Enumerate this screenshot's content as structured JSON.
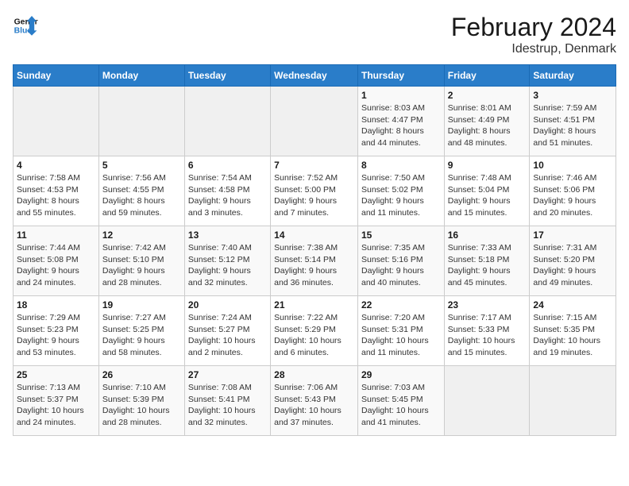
{
  "header": {
    "logo_line1": "General",
    "logo_line2": "Blue",
    "title": "February 2024",
    "subtitle": "Idestrup, Denmark"
  },
  "calendar": {
    "days_of_week": [
      "Sunday",
      "Monday",
      "Tuesday",
      "Wednesday",
      "Thursday",
      "Friday",
      "Saturday"
    ],
    "weeks": [
      [
        {
          "day": "",
          "info": ""
        },
        {
          "day": "",
          "info": ""
        },
        {
          "day": "",
          "info": ""
        },
        {
          "day": "",
          "info": ""
        },
        {
          "day": "1",
          "info": "Sunrise: 8:03 AM\nSunset: 4:47 PM\nDaylight: 8 hours\nand 44 minutes."
        },
        {
          "day": "2",
          "info": "Sunrise: 8:01 AM\nSunset: 4:49 PM\nDaylight: 8 hours\nand 48 minutes."
        },
        {
          "day": "3",
          "info": "Sunrise: 7:59 AM\nSunset: 4:51 PM\nDaylight: 8 hours\nand 51 minutes."
        }
      ],
      [
        {
          "day": "4",
          "info": "Sunrise: 7:58 AM\nSunset: 4:53 PM\nDaylight: 8 hours\nand 55 minutes."
        },
        {
          "day": "5",
          "info": "Sunrise: 7:56 AM\nSunset: 4:55 PM\nDaylight: 8 hours\nand 59 minutes."
        },
        {
          "day": "6",
          "info": "Sunrise: 7:54 AM\nSunset: 4:58 PM\nDaylight: 9 hours\nand 3 minutes."
        },
        {
          "day": "7",
          "info": "Sunrise: 7:52 AM\nSunset: 5:00 PM\nDaylight: 9 hours\nand 7 minutes."
        },
        {
          "day": "8",
          "info": "Sunrise: 7:50 AM\nSunset: 5:02 PM\nDaylight: 9 hours\nand 11 minutes."
        },
        {
          "day": "9",
          "info": "Sunrise: 7:48 AM\nSunset: 5:04 PM\nDaylight: 9 hours\nand 15 minutes."
        },
        {
          "day": "10",
          "info": "Sunrise: 7:46 AM\nSunset: 5:06 PM\nDaylight: 9 hours\nand 20 minutes."
        }
      ],
      [
        {
          "day": "11",
          "info": "Sunrise: 7:44 AM\nSunset: 5:08 PM\nDaylight: 9 hours\nand 24 minutes."
        },
        {
          "day": "12",
          "info": "Sunrise: 7:42 AM\nSunset: 5:10 PM\nDaylight: 9 hours\nand 28 minutes."
        },
        {
          "day": "13",
          "info": "Sunrise: 7:40 AM\nSunset: 5:12 PM\nDaylight: 9 hours\nand 32 minutes."
        },
        {
          "day": "14",
          "info": "Sunrise: 7:38 AM\nSunset: 5:14 PM\nDaylight: 9 hours\nand 36 minutes."
        },
        {
          "day": "15",
          "info": "Sunrise: 7:35 AM\nSunset: 5:16 PM\nDaylight: 9 hours\nand 40 minutes."
        },
        {
          "day": "16",
          "info": "Sunrise: 7:33 AM\nSunset: 5:18 PM\nDaylight: 9 hours\nand 45 minutes."
        },
        {
          "day": "17",
          "info": "Sunrise: 7:31 AM\nSunset: 5:20 PM\nDaylight: 9 hours\nand 49 minutes."
        }
      ],
      [
        {
          "day": "18",
          "info": "Sunrise: 7:29 AM\nSunset: 5:23 PM\nDaylight: 9 hours\nand 53 minutes."
        },
        {
          "day": "19",
          "info": "Sunrise: 7:27 AM\nSunset: 5:25 PM\nDaylight: 9 hours\nand 58 minutes."
        },
        {
          "day": "20",
          "info": "Sunrise: 7:24 AM\nSunset: 5:27 PM\nDaylight: 10 hours\nand 2 minutes."
        },
        {
          "day": "21",
          "info": "Sunrise: 7:22 AM\nSunset: 5:29 PM\nDaylight: 10 hours\nand 6 minutes."
        },
        {
          "day": "22",
          "info": "Sunrise: 7:20 AM\nSunset: 5:31 PM\nDaylight: 10 hours\nand 11 minutes."
        },
        {
          "day": "23",
          "info": "Sunrise: 7:17 AM\nSunset: 5:33 PM\nDaylight: 10 hours\nand 15 minutes."
        },
        {
          "day": "24",
          "info": "Sunrise: 7:15 AM\nSunset: 5:35 PM\nDaylight: 10 hours\nand 19 minutes."
        }
      ],
      [
        {
          "day": "25",
          "info": "Sunrise: 7:13 AM\nSunset: 5:37 PM\nDaylight: 10 hours\nand 24 minutes."
        },
        {
          "day": "26",
          "info": "Sunrise: 7:10 AM\nSunset: 5:39 PM\nDaylight: 10 hours\nand 28 minutes."
        },
        {
          "day": "27",
          "info": "Sunrise: 7:08 AM\nSunset: 5:41 PM\nDaylight: 10 hours\nand 32 minutes."
        },
        {
          "day": "28",
          "info": "Sunrise: 7:06 AM\nSunset: 5:43 PM\nDaylight: 10 hours\nand 37 minutes."
        },
        {
          "day": "29",
          "info": "Sunrise: 7:03 AM\nSunset: 5:45 PM\nDaylight: 10 hours\nand 41 minutes."
        },
        {
          "day": "",
          "info": ""
        },
        {
          "day": "",
          "info": ""
        }
      ]
    ]
  }
}
